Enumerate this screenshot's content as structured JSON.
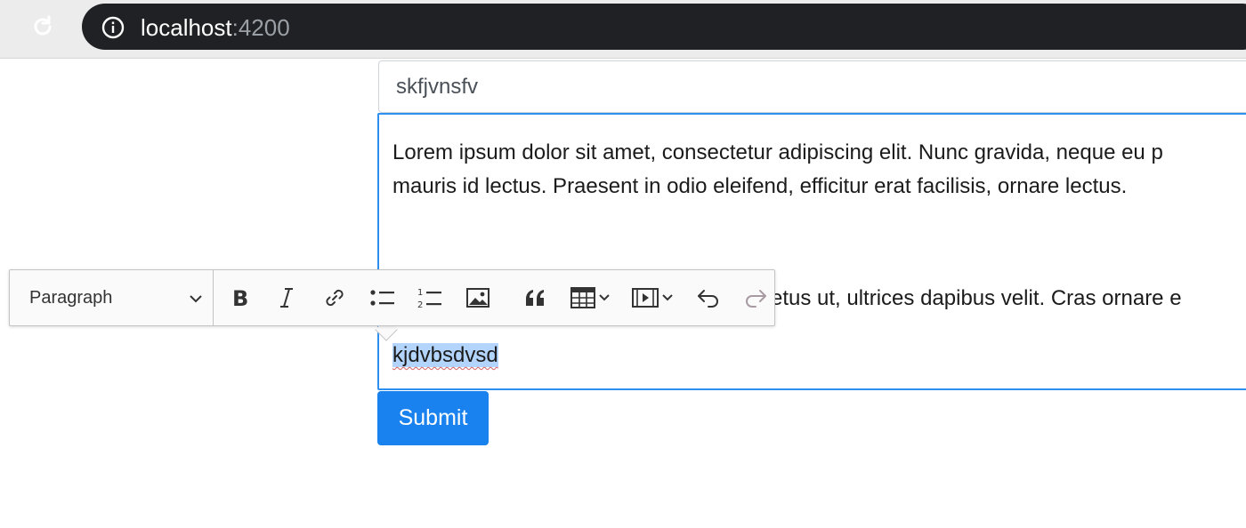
{
  "browser": {
    "url_host": "localhost",
    "url_port": ":4200"
  },
  "form": {
    "title_value": "skfjvnsfv",
    "editor": {
      "paragraph1_line1": "Lorem ipsum dolor sit amet, consectetur adipiscing elit. Nunc gravida, neque eu p",
      "paragraph1_line2": "mauris id lectus. Praesent in odio eleifend, efficitur erat facilisis, ornare lectus.",
      "paragraph2_visible": "metus ut, ultrices dapibus velit. Cras ornare e",
      "paragraph3_selected": "kjdvbsdvsd"
    },
    "submit_label": "Submit"
  },
  "toolbar": {
    "heading_value": "Paragraph",
    "buttons": [
      "bold",
      "italic",
      "link",
      "bulleted-list",
      "numbered-list",
      "image",
      "block-quote",
      "table",
      "media-embed",
      "undo",
      "redo"
    ]
  },
  "colors": {
    "primary": "#1a82ee",
    "focus_border": "#2d8ff0",
    "selection": "#b3d4fc",
    "url_bar": "#202124"
  }
}
